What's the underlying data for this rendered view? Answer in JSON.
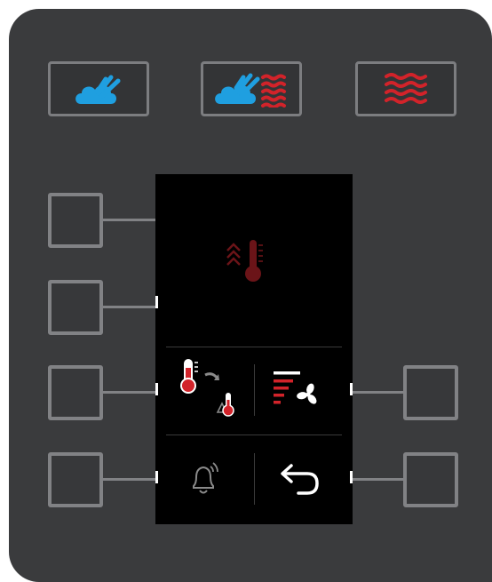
{
  "colors": {
    "panel": "#3a3b3d",
    "button_border": "#818285",
    "screen": "#000000",
    "steam_blue": "#1f9fe0",
    "heat_red": "#d2232a",
    "icon_white": "#ffffff",
    "icon_grey": "#8a8a8a",
    "icon_dark_red": "#6b1418"
  },
  "mode_buttons": [
    {
      "name": "steam-mode",
      "icon": "steam-icon"
    },
    {
      "name": "combination-mode",
      "icon": "steam-and-heat-icon"
    },
    {
      "name": "convection-mode",
      "icon": "hot-air-icon"
    }
  ],
  "screen": {
    "main_icon": "temperature-increase-icon",
    "cells": [
      {
        "name": "core-temperature-delta-t",
        "icon": "delta-t-thermometer-icon"
      },
      {
        "name": "fan-speed",
        "icon": "fan-speed-icon"
      },
      {
        "name": "alarm",
        "icon": "bell-icon"
      },
      {
        "name": "back",
        "icon": "back-arrow-icon"
      }
    ]
  },
  "side_buttons": {
    "left": [
      "left-button-1",
      "left-button-2",
      "left-button-3",
      "left-button-4"
    ],
    "right": [
      "right-button-3",
      "right-button-4"
    ]
  }
}
